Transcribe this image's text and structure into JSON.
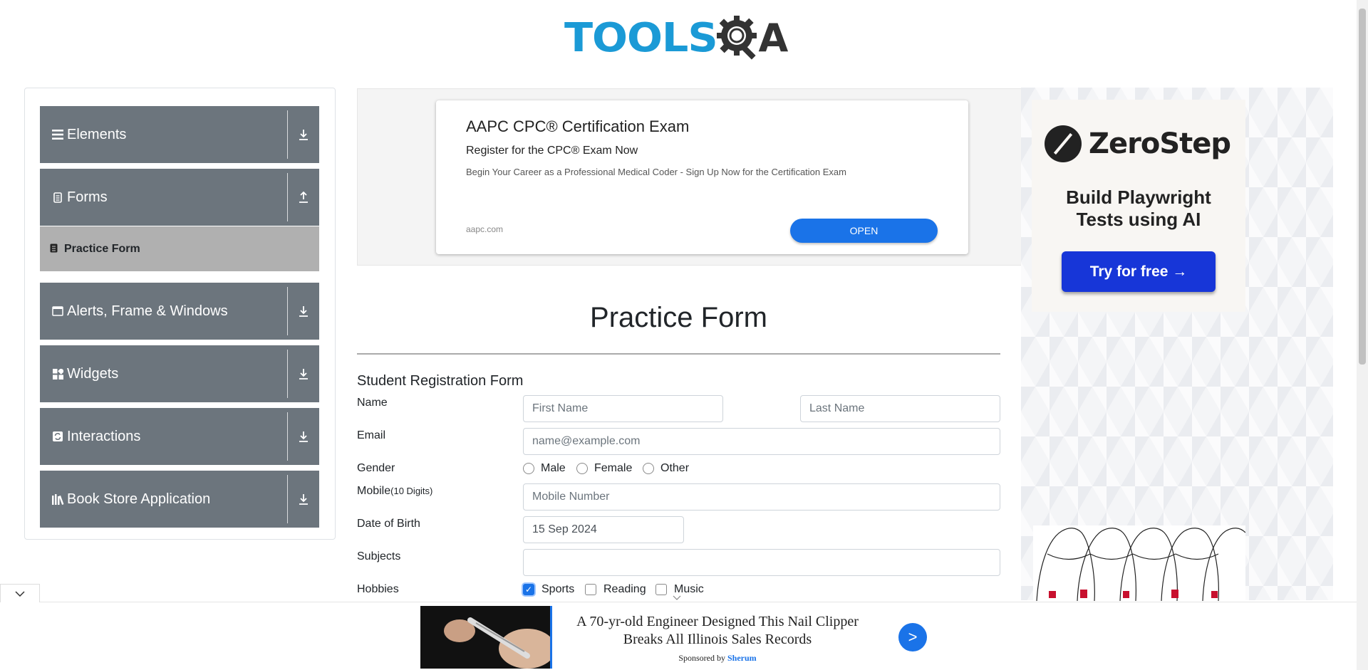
{
  "header": {
    "logo_text_left": "TOOLS",
    "logo_text_right": "A"
  },
  "sidebar": {
    "groups": [
      {
        "label": "Elements",
        "icon": "hamburger-icon",
        "arrow": "down"
      },
      {
        "label": "Forms",
        "icon": "document-icon",
        "arrow": "up"
      },
      {
        "label": "Alerts, Frame & Windows",
        "icon": "window-icon",
        "arrow": "down"
      },
      {
        "label": "Widgets",
        "icon": "widgets-icon",
        "arrow": "down"
      },
      {
        "label": "Interactions",
        "icon": "interactions-icon",
        "arrow": "down"
      },
      {
        "label": "Book Store Application",
        "icon": "books-icon",
        "arrow": "down"
      }
    ],
    "subitem": {
      "label": "Practice Form",
      "icon": "form-icon"
    }
  },
  "top_ad": {
    "title": "AAPC CPC® Certification Exam",
    "subtitle": "Register for the CPC® Exam Now",
    "description": "Begin Your Career as a Professional Medical Coder - Sign Up Now for the Certification Exam",
    "domain": "aapc.com",
    "button": "OPEN"
  },
  "right_ad": {
    "brand": "ZeroStep",
    "headline_line1": "Build Playwright",
    "headline_line2": "Tests using AI",
    "button": "Try for free →"
  },
  "form": {
    "page_title": "Practice Form",
    "title": "Student Registration Form",
    "labels": {
      "name": "Name",
      "email": "Email",
      "gender": "Gender",
      "mobile": "Mobile",
      "mobile_hint": "(10 Digits)",
      "dob": "Date of Birth",
      "subjects": "Subjects",
      "hobbies": "Hobbies"
    },
    "placeholders": {
      "first_name": "First Name",
      "last_name": "Last Name",
      "email": "name@example.com",
      "mobile": "Mobile Number"
    },
    "dob_value": "15 Sep 2024",
    "genders": [
      "Male",
      "Female",
      "Other"
    ],
    "hobbies": [
      {
        "label": "Sports",
        "checked": true
      },
      {
        "label": "Reading",
        "checked": false
      },
      {
        "label": "Music",
        "checked": false
      }
    ]
  },
  "bottom_ad": {
    "text": "A 70-yr-old Engineer Designed This Nail Clipper Breaks All Illinois Sales Records",
    "sponsored_prefix": "Sponsored by",
    "sponsor": "Sherum",
    "button": ">"
  },
  "colors": {
    "accent": "#1a73e8",
    "sidebar_group": "#6c757d",
    "sidebar_active": "#b0b0b0",
    "logo_blue": "#1b9ad6"
  }
}
